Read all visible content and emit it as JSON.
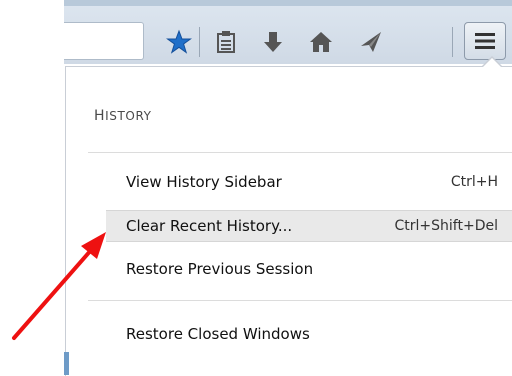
{
  "colors": {
    "accent_star": "#1f6fc9",
    "icon_gray": "#555555",
    "annotation_arrow": "#ee1111"
  },
  "toolbar": {
    "icons": [
      "bookmark-star-icon",
      "reading-list-icon",
      "downloads-icon",
      "home-icon",
      "send-icon",
      "hamburger-menu-icon"
    ]
  },
  "history_panel": {
    "heading": "History",
    "items": [
      {
        "label": "View History Sidebar",
        "shortcut": "Ctrl+H"
      },
      {
        "label": "Clear Recent History...",
        "shortcut": "Ctrl+Shift+Del",
        "highlighted": true
      },
      {
        "label": "Restore Previous Session",
        "shortcut": ""
      },
      {
        "label": "Restore Closed Windows",
        "shortcut": ""
      }
    ]
  }
}
